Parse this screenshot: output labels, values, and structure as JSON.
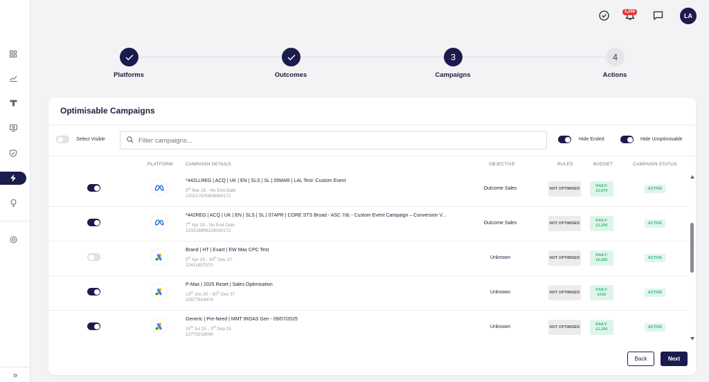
{
  "topbar": {
    "notification_count": "1,255",
    "avatar_initials": "LA"
  },
  "stepper": [
    {
      "label": "Platforms",
      "number": "",
      "state": "done"
    },
    {
      "label": "Outcomes",
      "number": "",
      "state": "done"
    },
    {
      "label": "Campaigns",
      "number": "3",
      "state": "current"
    },
    {
      "label": "Actions",
      "number": "4",
      "state": "todo"
    }
  ],
  "card": {
    "title": "Optimisable Campaigns",
    "select_visible_label": "Select Visible",
    "filter_placeholder": "Filter campaigns...",
    "hide_ended_label": "Hide Ended",
    "hide_unoptimisable_label": "Hide Unoptimisable"
  },
  "columns": {
    "platform": "PLATFORM",
    "details": "CAMPAIGN DETAILS",
    "objective": "OBJECTIVE",
    "rules": "RULES",
    "budget": "BUDGET",
    "status": "CAMPAIGN STATUS"
  },
  "campaigns": [
    {
      "enabled": true,
      "platform": "meta",
      "name": "*442LLREG | ACQ | UK | EN | SLS | SL | 05MAR | LAL Test- Custom Event",
      "start_day": "5",
      "start_sup": "th",
      "start_rest": " Mar 25 - No End Date",
      "end_day": "",
      "end_sup": "",
      "end_rest": "",
      "id": "120217625609060172",
      "objective": "Outcome Sales",
      "rules": "NOT OPTIMISED",
      "budget_label": "DAILY:",
      "budget_value": "£2,970",
      "status": "ACTIVE"
    },
    {
      "enabled": true,
      "platform": "meta",
      "name": "*442REG | ACQ | UK | EN | SLS | SL | 07APR | CORE STS Broad - ASC 7dc - Custom Event Campaign – Conversion V...",
      "start_day": "7",
      "start_sup": "th",
      "start_rest": " Apr 25 - No End Date",
      "end_day": "",
      "end_sup": "",
      "end_rest": "",
      "id": "120218898228030172",
      "objective": "Outcome Sales",
      "rules": "NOT OPTIMISED",
      "budget_label": "DAILY:",
      "budget_value": "£1,200",
      "status": "ACTIVE"
    },
    {
      "enabled": false,
      "platform": "google",
      "name": "Brand | HT | Exact | EW Max CPC Test",
      "start_day": "5",
      "start_sup": "th",
      "start_rest": " Apr 25 - ",
      "end_day": "30",
      "end_sup": "th",
      "end_rest": " Dec 37",
      "id": "22411957570",
      "objective": "Unknown",
      "rules": "NOT OPTIMISED",
      "budget_label": "DAILY:",
      "budget_value": "£5,500",
      "status": "ACTIVE"
    },
    {
      "enabled": true,
      "platform": "google",
      "name": "P-Max | 2025 Reset | Sales Optimisation",
      "start_day": "13",
      "start_sup": "th",
      "start_rest": " Jun 25 - ",
      "end_day": "30",
      "end_sup": "th",
      "end_rest": " Dec 37",
      "id": "22677814474",
      "objective": "Unknown",
      "rules": "NOT OPTIMISED",
      "budget_label": "DAILY:",
      "budget_value": "£216",
      "status": "ACTIVE"
    },
    {
      "enabled": true,
      "platform": "google",
      "name": "Generic | Pre-Need | MMT tROAS Gen - 09/07/2025",
      "start_day": "10",
      "start_sup": "th",
      "start_rest": " Jul 25 - ",
      "end_day": "3",
      "end_sup": "rd",
      "end_rest": " Sep 25",
      "id": "22770218099",
      "objective": "Unknown",
      "rules": "NOT OPTIMISED",
      "budget_label": "DAILY:",
      "budget_value": "£1,300",
      "status": "ACTIVE"
    }
  ],
  "buttons": {
    "back": "Back",
    "next": "Next"
  },
  "colors": {
    "primary": "#1b1b4d",
    "success_bg": "#dff5ea",
    "success_text": "#35b57a"
  }
}
